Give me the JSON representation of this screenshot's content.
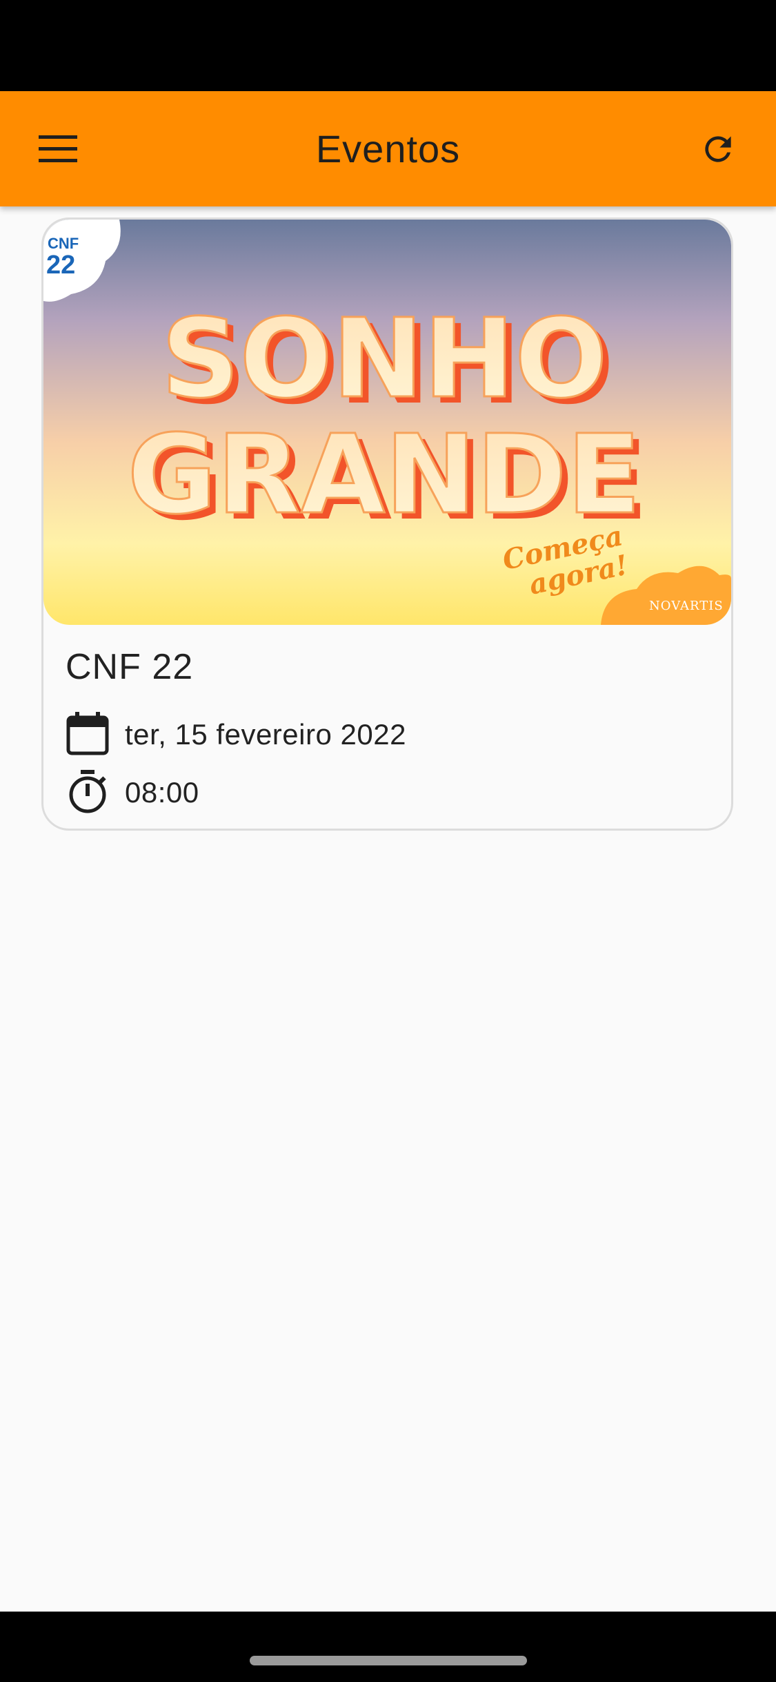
{
  "app_bar": {
    "title": "Eventos",
    "menu_icon": "menu-icon",
    "refresh_icon": "refresh-icon",
    "color": "#ff8c00"
  },
  "events": [
    {
      "banner": {
        "badge_top": "CNF",
        "badge_bottom": "22",
        "headline_1": "SONHO",
        "headline_2": "GRANDE",
        "tagline_1": "Começa",
        "tagline_2": "agora!",
        "brand": "NOVARTIS"
      },
      "title": "CNF 22",
      "date": "ter, 15 fevereiro 2022",
      "time": "08:00",
      "date_icon": "calendar-icon",
      "time_icon": "timer-icon"
    }
  ]
}
